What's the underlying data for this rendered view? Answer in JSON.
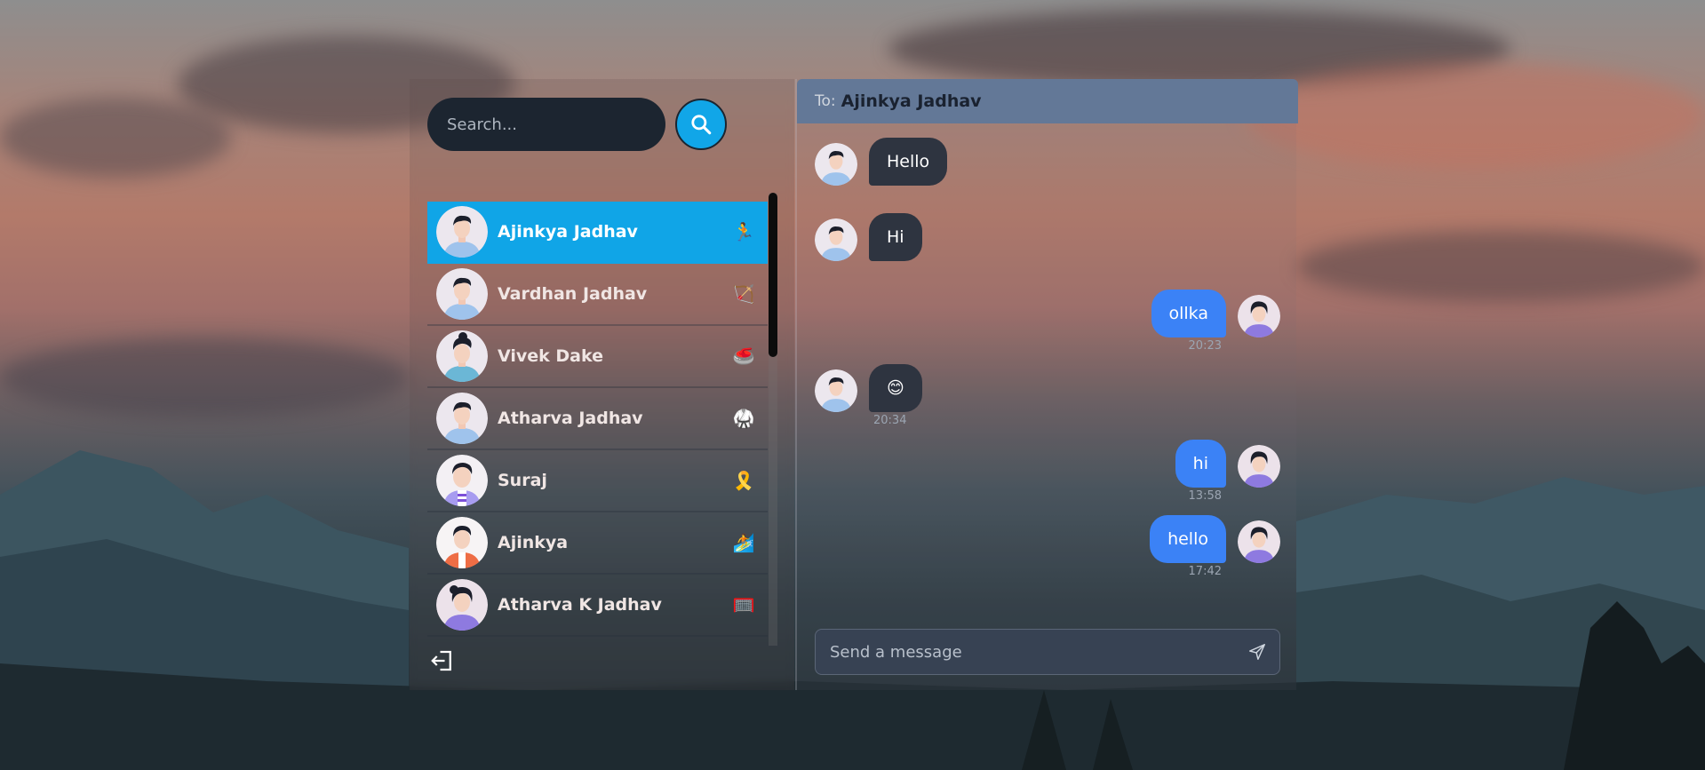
{
  "search": {
    "placeholder": "Search..."
  },
  "contacts": [
    {
      "name": "Ajinkya Jadhav",
      "emoji": "🏃",
      "avatar": "man-blue-shirt-avatar",
      "active": true
    },
    {
      "name": "Vardhan Jadhav",
      "emoji": "🏹",
      "avatar": "man-blue-shirt-avatar",
      "active": false
    },
    {
      "name": "Vivek Dake",
      "emoji": "🥌",
      "avatar": "man-curly-hair-avatar",
      "active": false
    },
    {
      "name": "Atharva Jadhav",
      "emoji": "🥋",
      "avatar": "man-blue-shirt-avatar",
      "active": false
    },
    {
      "name": "Suraj",
      "emoji": "🎗️",
      "avatar": "man-striped-shirt-avatar",
      "active": false
    },
    {
      "name": "Ajinkya",
      "emoji": "🏄",
      "avatar": "man-orange-jacket-avatar",
      "active": false
    },
    {
      "name": "Atharva K Jadhav",
      "emoji": "🥅",
      "avatar": "woman-purple-avatar",
      "active": false
    }
  ],
  "chat": {
    "to_label": "To:",
    "to_name": "Ajinkya Jadhav",
    "messages": [
      {
        "text": "Hello",
        "direction": "in",
        "time": ""
      },
      {
        "text": "Hi",
        "direction": "in",
        "time": ""
      },
      {
        "text": "ollka",
        "direction": "out",
        "time": "20:23"
      },
      {
        "text": "😊",
        "direction": "in",
        "time": "20:34"
      },
      {
        "text": "hi",
        "direction": "out",
        "time": "13:58"
      },
      {
        "text": "hello",
        "direction": "out",
        "time": "17:42"
      }
    ],
    "composer_placeholder": "Send a message"
  },
  "icons": {
    "search": "search-icon",
    "logout": "logout-icon",
    "send": "send-icon"
  },
  "colors": {
    "accent": "#10a5e7",
    "outgoing_bubble": "#3b82f6",
    "incoming_bubble": "#2e3440",
    "header": "#637897"
  }
}
